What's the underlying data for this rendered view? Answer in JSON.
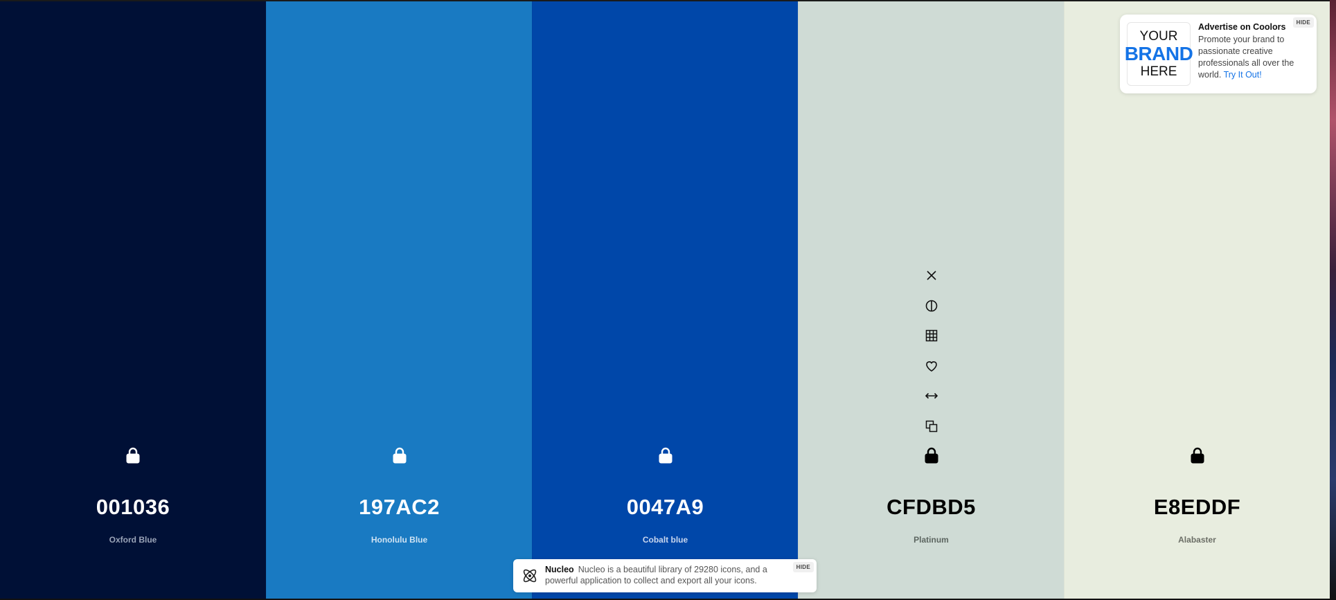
{
  "palette": {
    "colors": [
      {
        "hex": "001036",
        "name": "Oxford Blue",
        "bg": "#001036",
        "text_color": "#ffffff",
        "name_color": "#9aa4b8"
      },
      {
        "hex": "197AC2",
        "name": "Honolulu Blue",
        "bg": "#197AC2",
        "text_color": "#ffffff",
        "name_color": "#cfe3f3"
      },
      {
        "hex": "0047A9",
        "name": "Cobalt blue",
        "bg": "#0047A9",
        "text_color": "#ffffff",
        "name_color": "#c8d6ee"
      },
      {
        "hex": "CFDBD5",
        "name": "Platinum",
        "bg": "#CFDBD5",
        "text_color": "#000000",
        "name_color": "#5d6661"
      },
      {
        "hex": "E8EDDF",
        "name": "Alabaster",
        "bg": "#E8EDDF",
        "text_color": "#000000",
        "name_color": "#6b6e66"
      }
    ]
  },
  "swatch_tools": [
    "close-icon",
    "contrast-icon",
    "grid-icon",
    "heart-icon",
    "arrows-horizontal-icon",
    "copy-icon",
    "lock-icon"
  ],
  "ad": {
    "logo_line1": "YOUR",
    "logo_line2": "BRAND",
    "logo_line3": "HERE",
    "title": "Advertise on Coolors",
    "text": "Promote your brand to passionate creative professionals all over the world.",
    "link": "Try It Out!",
    "hide": "HIDE"
  },
  "nucleo": {
    "title": "Nucleo",
    "text": "Nucleo is a beautiful library of 29280 icons, and a powerful application to collect and export all your icons.",
    "hide": "HIDE"
  }
}
